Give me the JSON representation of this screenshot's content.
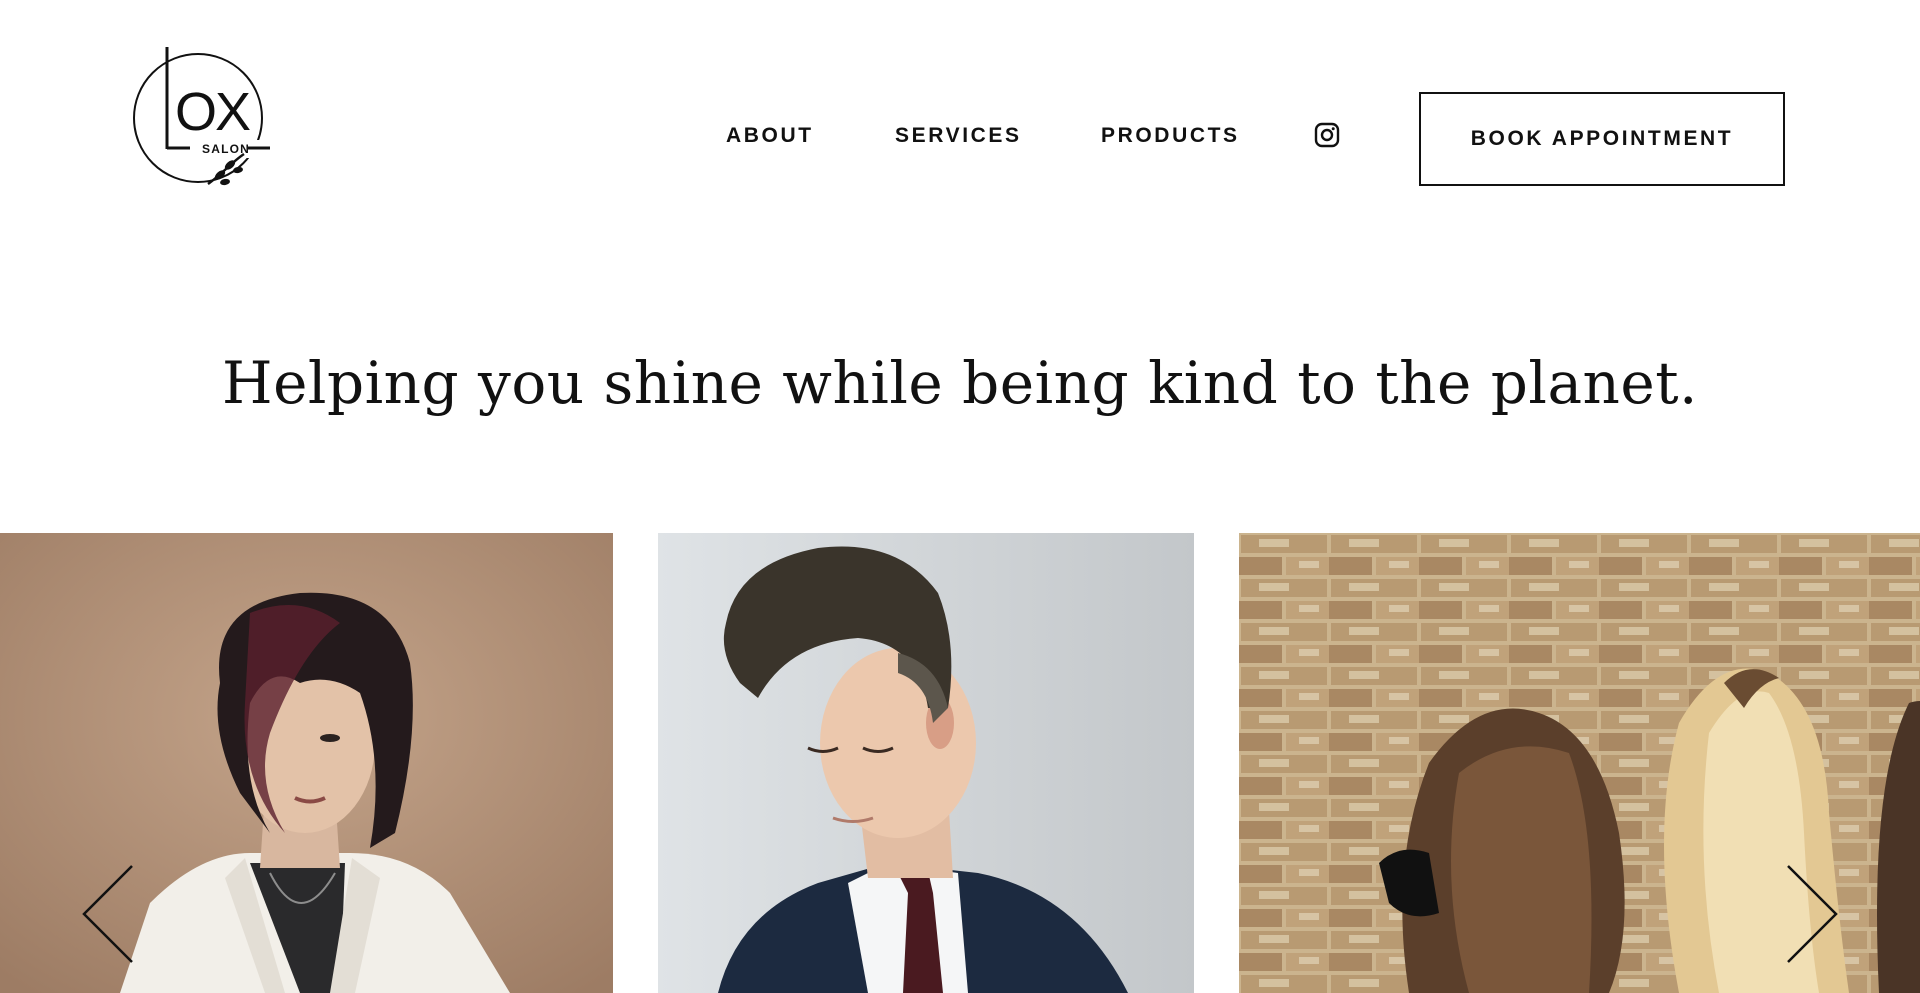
{
  "brand": {
    "logo_alt": "LOX SALON",
    "logo_letters": "OX",
    "logo_letter_l": "L",
    "logo_tagline": "SALON"
  },
  "nav": {
    "items": [
      {
        "label": "ABOUT"
      },
      {
        "label": "SERVICES"
      },
      {
        "label": "PRODUCTS"
      }
    ],
    "instagram_icon": "instagram-icon",
    "cta_label": "BOOK APPOINTMENT"
  },
  "hero": {
    "heading": "Helping you shine while being kind to the planet."
  },
  "gallery": {
    "slides": [
      {
        "subject": "portrait-woman-asymmetric-bob"
      },
      {
        "subject": "portrait-man-pompadour-suit"
      },
      {
        "subject": "group-women-long-hair-brick-wall"
      }
    ],
    "prev_icon": "chevron-left-icon",
    "next_icon": "chevron-right-icon"
  },
  "colors": {
    "text": "#111111",
    "background": "#ffffff",
    "button_border": "#111111"
  }
}
